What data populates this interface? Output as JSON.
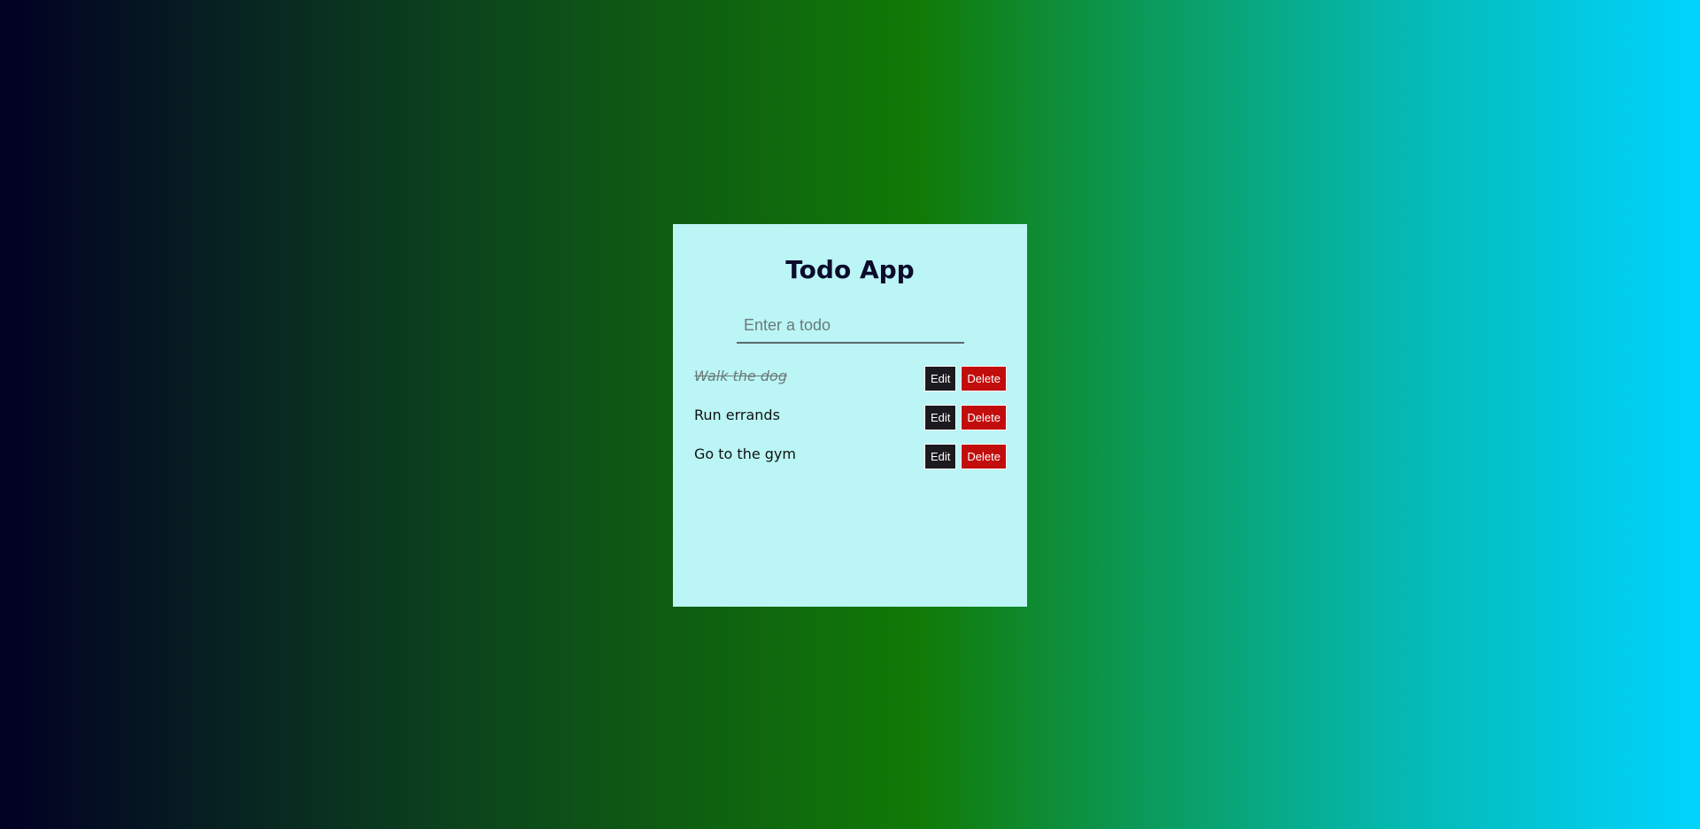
{
  "app": {
    "title": "Todo App"
  },
  "input": {
    "placeholder": "Enter a todo",
    "value": ""
  },
  "buttons": {
    "edit_label": "Edit",
    "delete_label": "Delete"
  },
  "todos": [
    {
      "text": "Walk the dog",
      "completed": true
    },
    {
      "text": "Run errands",
      "completed": false
    },
    {
      "text": "Go to the gym",
      "completed": false
    }
  ],
  "colors": {
    "card_background": "#bbf5f5",
    "edit_button": "#1b1b1f",
    "delete_button": "#c20d0d",
    "title_text": "#0b0b2b"
  }
}
